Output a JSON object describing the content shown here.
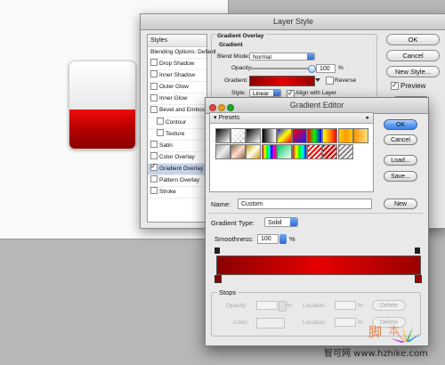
{
  "layer_style": {
    "title": "Layer Style",
    "styles_header": "Styles",
    "blending_options": "Blending Options: Default",
    "effects": [
      {
        "label": "Drop Shadow",
        "checked": false,
        "indent": false,
        "selected": false
      },
      {
        "label": "Inner Shadow",
        "checked": false,
        "indent": false,
        "selected": false
      },
      {
        "label": "Outer Glow",
        "checked": false,
        "indent": false,
        "selected": false
      },
      {
        "label": "Inner Glow",
        "checked": false,
        "indent": false,
        "selected": false
      },
      {
        "label": "Bevel and Emboss",
        "checked": false,
        "indent": false,
        "selected": false
      },
      {
        "label": "Contour",
        "checked": false,
        "indent": true,
        "selected": false
      },
      {
        "label": "Texture",
        "checked": false,
        "indent": true,
        "selected": false
      },
      {
        "label": "Satin",
        "checked": false,
        "indent": false,
        "selected": false
      },
      {
        "label": "Color Overlay",
        "checked": false,
        "indent": false,
        "selected": false
      },
      {
        "label": "Gradient Overlay",
        "checked": true,
        "indent": false,
        "selected": true
      },
      {
        "label": "Pattern Overlay",
        "checked": false,
        "indent": false,
        "selected": false
      },
      {
        "label": "Stroke",
        "checked": false,
        "indent": false,
        "selected": false
      }
    ],
    "section_title": "Gradient Overlay",
    "group_title": "Gradient",
    "blend_mode_label": "Blend Mode:",
    "blend_mode_value": "Normal",
    "opacity_label": "Opacity:",
    "opacity_value": "100",
    "opacity_unit": "%",
    "opacity_level": 1.0,
    "gradient_label": "Gradient:",
    "reverse_label": "Reverse",
    "style_label": "Style:",
    "style_value": "Linear",
    "align_label": "Align with Layer",
    "ok": "OK",
    "cancel": "Cancel",
    "new_style": "New Style...",
    "preview": "Preview"
  },
  "gradient_editor": {
    "title": "Gradient Editor",
    "presets_label": "Presets",
    "ok": "OK",
    "cancel": "Cancel",
    "load": "Load...",
    "save": "Save...",
    "name_label": "Name:",
    "name_value": "Custom",
    "new_button": "New",
    "gradient_type_label": "Gradient Type:",
    "gradient_type_value": "Solid",
    "smoothness_label": "Smoothness:",
    "smoothness_value": "100",
    "smoothness_unit": "%",
    "stops_label": "Stops",
    "opacity_label": "Opacity:",
    "color_label": "Color:",
    "location_label": "Location:",
    "percent": "%",
    "delete": "Delete",
    "gradient_colors": [
      "#8a0000",
      "#e60000",
      "#9a0000"
    ]
  },
  "watermark": {
    "text": "智可网 www.hzhike.com"
  },
  "colors": {
    "accent_red": "#d40000",
    "selection_blue": "#c5d4ea",
    "button_blue": "#5e9ef2"
  }
}
